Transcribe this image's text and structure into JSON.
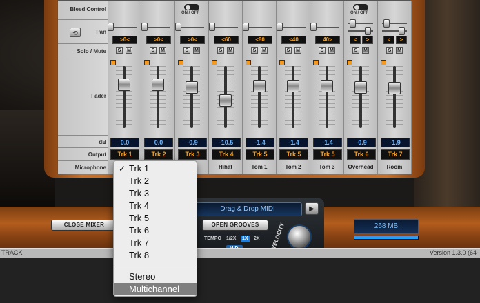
{
  "rows": {
    "bleed": "Bleed Control",
    "pan": "Pan",
    "solo_mute": "Solo / Mute",
    "fader": "Fader",
    "db": "dB",
    "output": "Output",
    "microphone": "Microphone"
  },
  "toggle_label": "ON / OFF",
  "solo_letter": "S",
  "mute_letter": "M",
  "pan_left": "<",
  "pan_right": ">",
  "link_glyph": "⟲",
  "channels": [
    {
      "pan": ">0<",
      "db": "0.0",
      "out": "Trk 1",
      "mic": "",
      "fader": 0.7
    },
    {
      "pan": ">0<",
      "db": "0.0",
      "out": "Trk 2",
      "mic": "",
      "fader": 0.7
    },
    {
      "pan": ">0<",
      "db": "-0.9",
      "out": "Trk 3",
      "mic": "D",
      "fader": 0.66
    },
    {
      "pan": "<60",
      "db": "-10.5",
      "out": "Trk 4",
      "mic": "Hihat",
      "fader": 0.45
    },
    {
      "pan": "<80",
      "db": "-1.4",
      "out": "Trk 5",
      "mic": "Tom 1",
      "fader": 0.68
    },
    {
      "pan": "<40",
      "db": "-1.4",
      "out": "Trk 5",
      "mic": "Tom 2",
      "fader": 0.68
    },
    {
      "pan": "40>",
      "db": "-1.4",
      "out": "Trk 5",
      "mic": "Tom 3",
      "fader": 0.68
    },
    {
      "pan": "",
      "db": "-0.9",
      "out": "Trk 6",
      "mic": "Overhead",
      "fader": 0.66
    },
    {
      "pan": "",
      "db": "-1.9",
      "out": "Trk 7",
      "mic": "Room",
      "fader": 0.64
    }
  ],
  "menu": {
    "check_mark": "✓",
    "items": [
      "Trk 1",
      "Trk 2",
      "Trk 3",
      "Trk 4",
      "Trk 5",
      "Trk 6",
      "Trk 7",
      "Trk 8"
    ],
    "special": [
      "Stereo",
      "Multichannel"
    ],
    "selected": "Trk 1",
    "highlighted": "Multichannel"
  },
  "controls": {
    "close_mixer": "CLOSE MIXER",
    "drag_drop": "Drag & Drop MIDI",
    "play_glyph": "▶",
    "open_grooves": "OPEN GROOVES",
    "tempo": "TEMPO",
    "tempo_half": "1/2X",
    "tempo_one": "1X",
    "tempo_double": "2X",
    "midi": "MIDI",
    "velocity": "VELOCITY",
    "memory": "268 MB"
  },
  "status": {
    "left": "TRACK",
    "right": "Version 1.3.0 (64-"
  }
}
